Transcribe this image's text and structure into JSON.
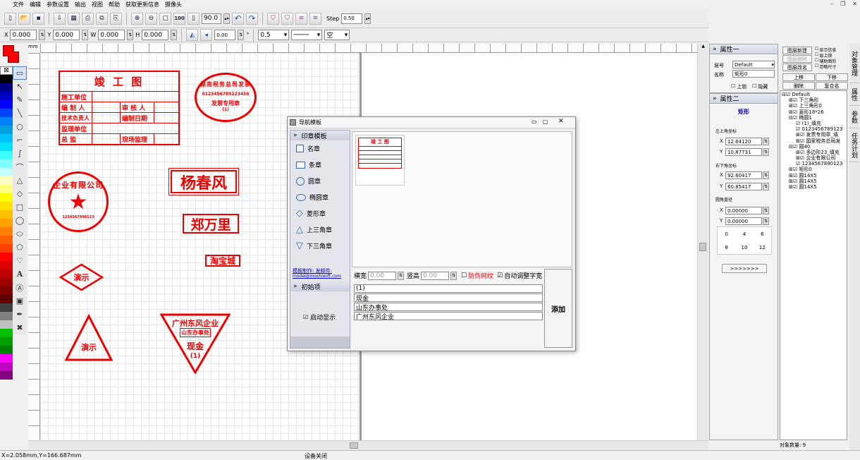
{
  "menu": [
    "文件",
    "编辑",
    "参数设置",
    "输出",
    "视图",
    "帮助",
    "获取更新信息",
    "摄像头"
  ],
  "toolbar1": {
    "zoom_value": "90.0",
    "hundred": "100",
    "step_label": "Step",
    "step_value": "0.50"
  },
  "toolbar2": {
    "x_label": "X",
    "x_value": "0.000",
    "y_label": "Y",
    "y_value": "0.000",
    "w_label": "W",
    "w_value": "0.000",
    "h_label": "H",
    "h_value": "0.000",
    "angle": "0.00",
    "degree": "°",
    "line_width": "0.5",
    "dash_style": "空"
  },
  "ruler_unit": "mm",
  "stamps": {
    "table_title": "竣 工 图",
    "table_rows": [
      [
        "施工单位",
        ""
      ],
      [
        "编 制 人",
        "审 核 人"
      ],
      [
        "技术负责人",
        "编制日期"
      ],
      [
        "监理单位",
        ""
      ],
      [
        "总 监",
        "现场监理"
      ]
    ],
    "oval_text": "湖南税务总局发票",
    "oval_number": "0123456789123456",
    "oval_bottom": "发票专用章",
    "oval_num": "(1)",
    "round_text": "企业有限公司",
    "round_digits": "1234567890123",
    "name1": "杨春风",
    "name2": "郑万里",
    "shop": "淘宝城",
    "diamond": "演示",
    "triangle": "演示",
    "invtri_line1": "广州东风企业",
    "invtri_line2": "山东办事处",
    "invtri_line3": "现金",
    "invtri_line4": "(1)"
  },
  "dialog": {
    "title": "导航模板",
    "section1": "印章模板",
    "items": [
      "名章",
      "条章",
      "圆章",
      "椭圆章",
      "菱形章",
      "上三角章",
      "下三角章"
    ],
    "link1": "模板制作: 发邮件:",
    "link2": "model@moshixoft.com",
    "section2": "初始项",
    "startup": "启动显示",
    "h_width_label": "横宽",
    "h_width_value": "0.00",
    "v_height_label": "竖高",
    "v_height_value": "0.00",
    "anticounterfeit": "防伪网纹",
    "auto_adjust": "自动调整字宽",
    "lines": [
      "(1)",
      "现金",
      "山东办事处",
      "广州东风企业"
    ],
    "add_button": "添加"
  },
  "props1": {
    "title": "属性一",
    "layer_label": "层号",
    "layer_value": "Default",
    "name_label": "名称",
    "name_value": "矩形0",
    "lock": "上锁",
    "hide": "隐藏"
  },
  "props2": {
    "title": "属性二",
    "shape": "矩形",
    "topleft_label": "左上角坐标",
    "tl_x": "12.64120",
    "tl_y": "10.87731",
    "bottomright_label": "右下角坐标",
    "br_x": "92.60417",
    "br_y": "60.85417",
    "radius_label": "圆角直径",
    "r_x": "0.00000",
    "r_y": "0.00000",
    "grid": [
      "0",
      "4",
      "6",
      "8",
      "10",
      "12"
    ],
    "more": ">>>>>>>"
  },
  "layerctl": {
    "new": "图层新建",
    "del": "图层删除",
    "rename": "图层改名",
    "show_info": "显示信息",
    "show_lock": "层上锁",
    "aux": "辅助图形",
    "ignore_size": "忽略尺寸",
    "up": "上移",
    "down": "下移",
    "delete": "删除",
    "recombine": "复合名"
  },
  "tree": [
    "Default",
    "下三角形",
    "上三角形0",
    "菱形18*26",
    "椭圆1",
    "(1)_填充",
    "0123456789123",
    "发票专用章_填",
    "国家税务总局发",
    "圆40",
    "多边形23_填充",
    "企业有限公司",
    "1234567890123",
    "矩形0",
    "圆14X5",
    "圆14X5",
    "圆14X5"
  ],
  "object_count": "对象数量: 9",
  "vtabs": [
    "对象管理",
    "属性",
    "参数",
    "任务计划"
  ],
  "status": {
    "coords": "X=2.058mm,Y=166.687mm",
    "device": "设备关闭"
  },
  "colors": {
    "stamp_red": "#e00000"
  }
}
